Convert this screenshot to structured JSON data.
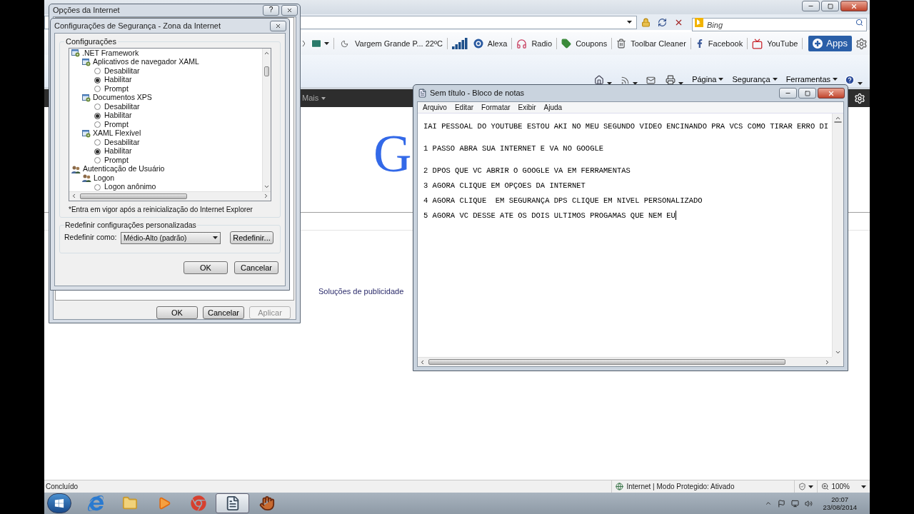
{
  "browser": {
    "search": {
      "placeholder": "Bing"
    },
    "toolbar": [
      {
        "kind": "weather",
        "label": "Vargem Grande P... 22ºC"
      },
      {
        "kind": "alexa",
        "label": "Alexa"
      },
      {
        "kind": "radio",
        "label": "Radio"
      },
      {
        "kind": "coupons",
        "label": "Coupons"
      },
      {
        "kind": "cleaner",
        "label": "Toolbar Cleaner"
      },
      {
        "kind": "facebook",
        "label": "Facebook"
      },
      {
        "kind": "youtube",
        "label": "YouTube"
      }
    ],
    "apps_button": "Apps",
    "command_bar": [
      "Página",
      "Segurança",
      "Ferramentas"
    ],
    "google_bar": {
      "more": "Mais"
    },
    "logo": "G",
    "footer_link": "Soluções de publicidade",
    "status_bar": {
      "text": "Concluído",
      "zone": "Internet | Modo Protegido: Ativado",
      "zoom": "100%"
    }
  },
  "internet_options": {
    "title": "Opções da Internet",
    "help_button": "?",
    "buttons": [
      {
        "label": "OK",
        "disabled": false
      },
      {
        "label": "Cancelar",
        "disabled": false
      },
      {
        "label": "Aplicar",
        "disabled": true
      }
    ]
  },
  "security_settings": {
    "title": "Configurações de Segurança - Zona da Internet",
    "settings_group": "Configurações",
    "tree": [
      {
        "label": ".NET Framework",
        "kind": "category",
        "children": [
          {
            "label": "Aplicativos de navegador XAML",
            "kind": "category",
            "children": [
              {
                "label": "Desabilitar",
                "kind": "option",
                "selected": false
              },
              {
                "label": "Habilitar",
                "kind": "option",
                "selected": true
              },
              {
                "label": "Prompt",
                "kind": "option",
                "selected": false
              }
            ]
          },
          {
            "label": "Documentos XPS",
            "kind": "category",
            "children": [
              {
                "label": "Desabilitar",
                "kind": "option",
                "selected": false
              },
              {
                "label": "Habilitar",
                "kind": "option",
                "selected": true
              },
              {
                "label": "Prompt",
                "kind": "option",
                "selected": false
              }
            ]
          },
          {
            "label": "XAML Flexível",
            "kind": "category",
            "children": [
              {
                "label": "Desabilitar",
                "kind": "option",
                "selected": false
              },
              {
                "label": "Habilitar",
                "kind": "option",
                "selected": true
              },
              {
                "label": "Prompt",
                "kind": "option",
                "selected": false
              }
            ]
          }
        ]
      },
      {
        "label": "Autenticação de Usuário",
        "kind": "user_category",
        "children": [
          {
            "label": "Logon",
            "kind": "user_category",
            "children": [
              {
                "label": "Logon anônimo",
                "kind": "option",
                "selected": false
              }
            ]
          }
        ]
      }
    ],
    "note": "*Entra em vigor após a reinicialização do Internet Explorer",
    "reset_group": "Redefinir configurações personalizadas",
    "reset_label": "Redefinir como:",
    "reset_level": "Médio-Alto (padrão)",
    "reset_button": "Redefinir...",
    "buttons": [
      "OK",
      "Cancelar"
    ]
  },
  "notepad": {
    "title": "Sem título - Bloco de notas",
    "menu": [
      "Arquivo",
      "Editar",
      "Formatar",
      "Exibir",
      "Ajuda"
    ],
    "paragraphs": [
      [
        "IAI PESSOAL DO YOUTUBE ESTOU AKI NO MEU SEGUNDO VIDEO ENCINANDO PRA VCS COMO TIRAR ERRO DI"
      ],
      [
        "1 PASSO ABRA SUA INTERNET E VA NO GOOGLE"
      ],
      [
        "2 DPOS QUE VC ABRIR O GOOGLE VA EM FERRAMENTAS",
        "3 AGORA CLIQUE EM OPÇOES DA INTERNET",
        "4 AGORA CLIQUE  EM SEGURANÇA DPS CLIQUE EM NIVEL PERSONALIZADO",
        "5 AGORA VC DESSE ATE OS DOIS ULTIMOS PROGAMAS QUE NEM EU"
      ]
    ]
  },
  "taskbar": {
    "apps": [
      {
        "kind": "ie",
        "selected": false
      },
      {
        "kind": "folder",
        "selected": false
      },
      {
        "kind": "media",
        "selected": false
      },
      {
        "kind": "chrome",
        "selected": false
      },
      {
        "kind": "notepad",
        "selected": true
      },
      {
        "kind": "glove",
        "selected": false
      }
    ],
    "time": "20:07",
    "date": "23/08/2014"
  }
}
